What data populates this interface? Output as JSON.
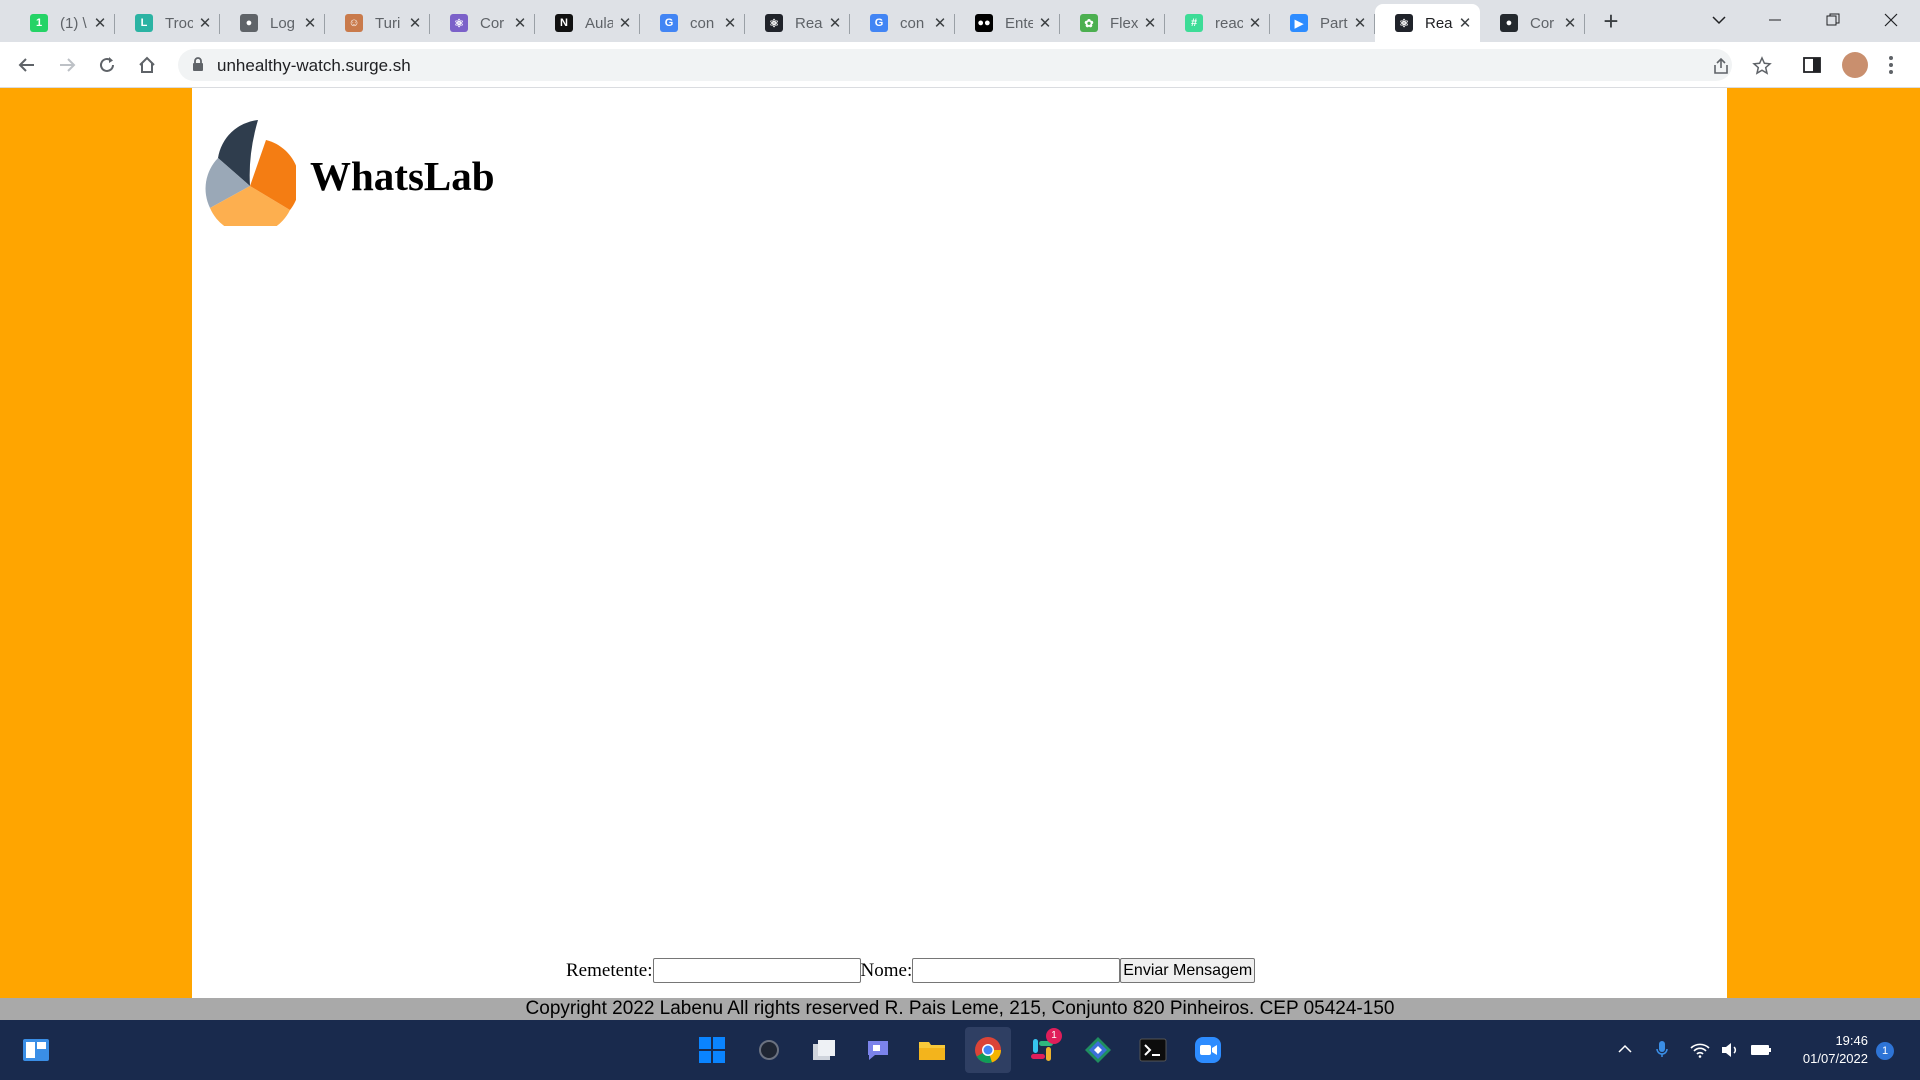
{
  "browser": {
    "tabs": [
      {
        "title": "(1) \\",
        "favicon": "whatsapp-icon",
        "color": "#25d366",
        "glyph": "1"
      },
      {
        "title": "Troc",
        "favicon": "labenu-icon",
        "color": "#2bb3a3",
        "glyph": "L"
      },
      {
        "title": "Log",
        "favicon": "globe-icon",
        "color": "#5f6368",
        "glyph": "●"
      },
      {
        "title": "Turi",
        "favicon": "avatar-icon",
        "color": "#c97a4b",
        "glyph": "☺"
      },
      {
        "title": "Cor",
        "favicon": "react-icon",
        "color": "#7b61c9",
        "glyph": "⚛"
      },
      {
        "title": "Aula",
        "favicon": "notion-icon",
        "color": "#111111",
        "glyph": "N"
      },
      {
        "title": "con",
        "favicon": "google-icon",
        "color": "#4285f4",
        "glyph": "G"
      },
      {
        "title": "Rea",
        "favicon": "react-icon",
        "color": "#20232a",
        "glyph": "⚛"
      },
      {
        "title": "con",
        "favicon": "google-icon",
        "color": "#4285f4",
        "glyph": "G"
      },
      {
        "title": "Ente",
        "favicon": "medium-icon",
        "color": "#000000",
        "glyph": "●●"
      },
      {
        "title": "Flex",
        "favicon": "frog-icon",
        "color": "#4caf50",
        "glyph": "✿"
      },
      {
        "title": "reac",
        "favicon": "code-icon",
        "color": "#3ddc97",
        "glyph": "#"
      },
      {
        "title": "Part",
        "favicon": "zoom-icon",
        "color": "#2d8cff",
        "glyph": "▶"
      },
      {
        "title": "Rea",
        "favicon": "react-icon",
        "color": "#20232a",
        "glyph": "⚛",
        "active": true
      },
      {
        "title": "Cor",
        "favicon": "github-icon",
        "color": "#24292e",
        "glyph": "●"
      }
    ],
    "url": "unhealthy-watch.surge.sh"
  },
  "app": {
    "title": "WhatsLab",
    "form": {
      "sender_label": "Remetente:",
      "sender_value": "",
      "name_label": "Nome:",
      "name_value": "",
      "send_label": "Enviar Mensagem"
    },
    "footer": "Copyright 2022 Labenu All rights reserved R. Pais Leme, 215, Conjunto 820 Pinheiros. CEP 05424-150"
  },
  "taskbar": {
    "time": "19:46",
    "date": "01/07/2022",
    "notifications": "1",
    "slack_badge": "1"
  },
  "colors": {
    "page_background": "#ffa500",
    "footer_background": "#a9a9a9",
    "taskbar": "#192a4d"
  }
}
